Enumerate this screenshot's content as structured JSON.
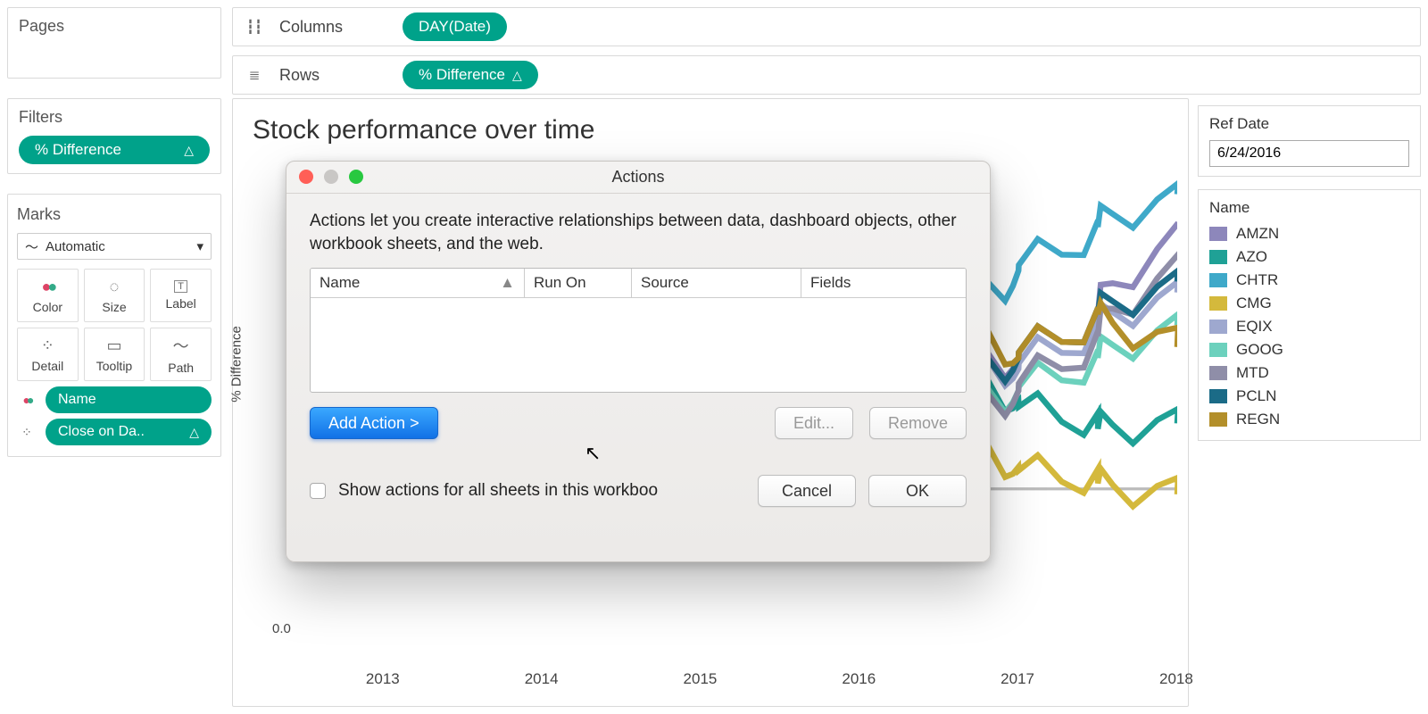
{
  "shelves": {
    "columns_label": "Columns",
    "rows_label": "Rows",
    "columns_pill": "DAY(Date)",
    "rows_pill": "% Difference"
  },
  "pages": {
    "title": "Pages"
  },
  "filters": {
    "title": "Filters",
    "pill": "% Difference"
  },
  "marks": {
    "title": "Marks",
    "mark_type": "Automatic",
    "cells": {
      "color": "Color",
      "size": "Size",
      "label": "Label",
      "detail": "Detail",
      "tooltip": "Tooltip",
      "path": "Path"
    },
    "pills": {
      "name": "Name",
      "close_on_date": "Close on Da.."
    }
  },
  "viz": {
    "title": "Stock performance over time",
    "y_label": "% Difference",
    "y_tick_zero": "0.0"
  },
  "parameter": {
    "title": "Ref Date",
    "value": "6/24/2016"
  },
  "legend": {
    "title": "Name",
    "items": [
      {
        "name": "AMZN",
        "color": "#8d87bb"
      },
      {
        "name": "AZO",
        "color": "#1fa196"
      },
      {
        "name": "CHTR",
        "color": "#3fa9c9"
      },
      {
        "name": "CMG",
        "color": "#d4b93c"
      },
      {
        "name": "EQIX",
        "color": "#9ea8cf"
      },
      {
        "name": "GOOG",
        "color": "#6cd1bd"
      },
      {
        "name": "MTD",
        "color": "#8f8ea8"
      },
      {
        "name": "PCLN",
        "color": "#1b6b87"
      },
      {
        "name": "REGN",
        "color": "#b38f2a"
      }
    ]
  },
  "dialog": {
    "title": "Actions",
    "description": "Actions let you create interactive relationships between data, dashboard objects, other workbook sheets, and the web.",
    "table_headers": {
      "name": "Name",
      "run_on": "Run On",
      "source": "Source",
      "fields": "Fields"
    },
    "add_action_btn": "Add Action >",
    "edit_btn": "Edit...",
    "remove_btn": "Remove",
    "show_all_label": "Show actions for all sheets in this workboo",
    "cancel_btn": "Cancel",
    "ok_btn": "OK"
  },
  "chart_data": {
    "type": "line",
    "title": "Stock performance over time",
    "xlabel": "",
    "ylabel": "% Difference",
    "x_ticks": [
      2013,
      2014,
      2015,
      2016,
      2017,
      2018
    ],
    "ylim": [
      -1.0,
      3.0
    ],
    "x_years": [
      2012.5,
      2013,
      2013.5,
      2014,
      2014.5,
      2015,
      2015.5,
      2016,
      2016.5,
      2017,
      2017.5,
      2018
    ],
    "series": [
      {
        "name": "AMZN",
        "color": "#8d87bb",
        "values": [
          0,
          0.05,
          0.1,
          0.25,
          0.2,
          0.3,
          0.6,
          0.9,
          1.0,
          1.2,
          1.6,
          2.4
        ]
      },
      {
        "name": "AZO",
        "color": "#1fa196",
        "values": [
          0,
          0.05,
          0.1,
          0.2,
          0.3,
          0.45,
          0.6,
          0.8,
          0.9,
          0.8,
          0.55,
          0.6
        ]
      },
      {
        "name": "CHTR",
        "color": "#3fa9c9",
        "values": [
          0,
          0.1,
          0.2,
          0.35,
          0.55,
          0.8,
          1.0,
          1.2,
          1.5,
          2.0,
          2.4,
          2.7
        ]
      },
      {
        "name": "CMG",
        "color": "#d4b93c",
        "values": [
          0,
          0.1,
          0.2,
          0.35,
          0.55,
          0.7,
          0.8,
          0.6,
          0.3,
          0.2,
          0.05,
          -0.05
        ]
      },
      {
        "name": "EQIX",
        "color": "#9ea8cf",
        "values": [
          0,
          0.02,
          -0.02,
          0.05,
          0.15,
          0.3,
          0.5,
          0.7,
          1.0,
          1.1,
          1.5,
          1.8
        ]
      },
      {
        "name": "GOOG",
        "color": "#6cd1bd",
        "values": [
          0,
          0.03,
          0.1,
          0.25,
          0.2,
          0.25,
          0.45,
          0.6,
          0.65,
          0.9,
          1.2,
          1.5
        ]
      },
      {
        "name": "MTD",
        "color": "#8f8ea8",
        "values": [
          0,
          0.04,
          0.08,
          0.2,
          0.18,
          0.3,
          0.4,
          0.45,
          0.55,
          0.9,
          1.4,
          2.1
        ]
      },
      {
        "name": "PCLN",
        "color": "#1b6b87",
        "values": [
          0,
          0.05,
          0.15,
          0.4,
          0.55,
          0.5,
          0.7,
          0.85,
          0.9,
          1.2,
          1.6,
          1.9
        ]
      },
      {
        "name": "REGN",
        "color": "#b38f2a",
        "values": [
          0,
          0.1,
          0.35,
          0.6,
          0.7,
          1.2,
          1.8,
          2.0,
          1.4,
          1.2,
          1.6,
          1.3
        ]
      }
    ]
  }
}
